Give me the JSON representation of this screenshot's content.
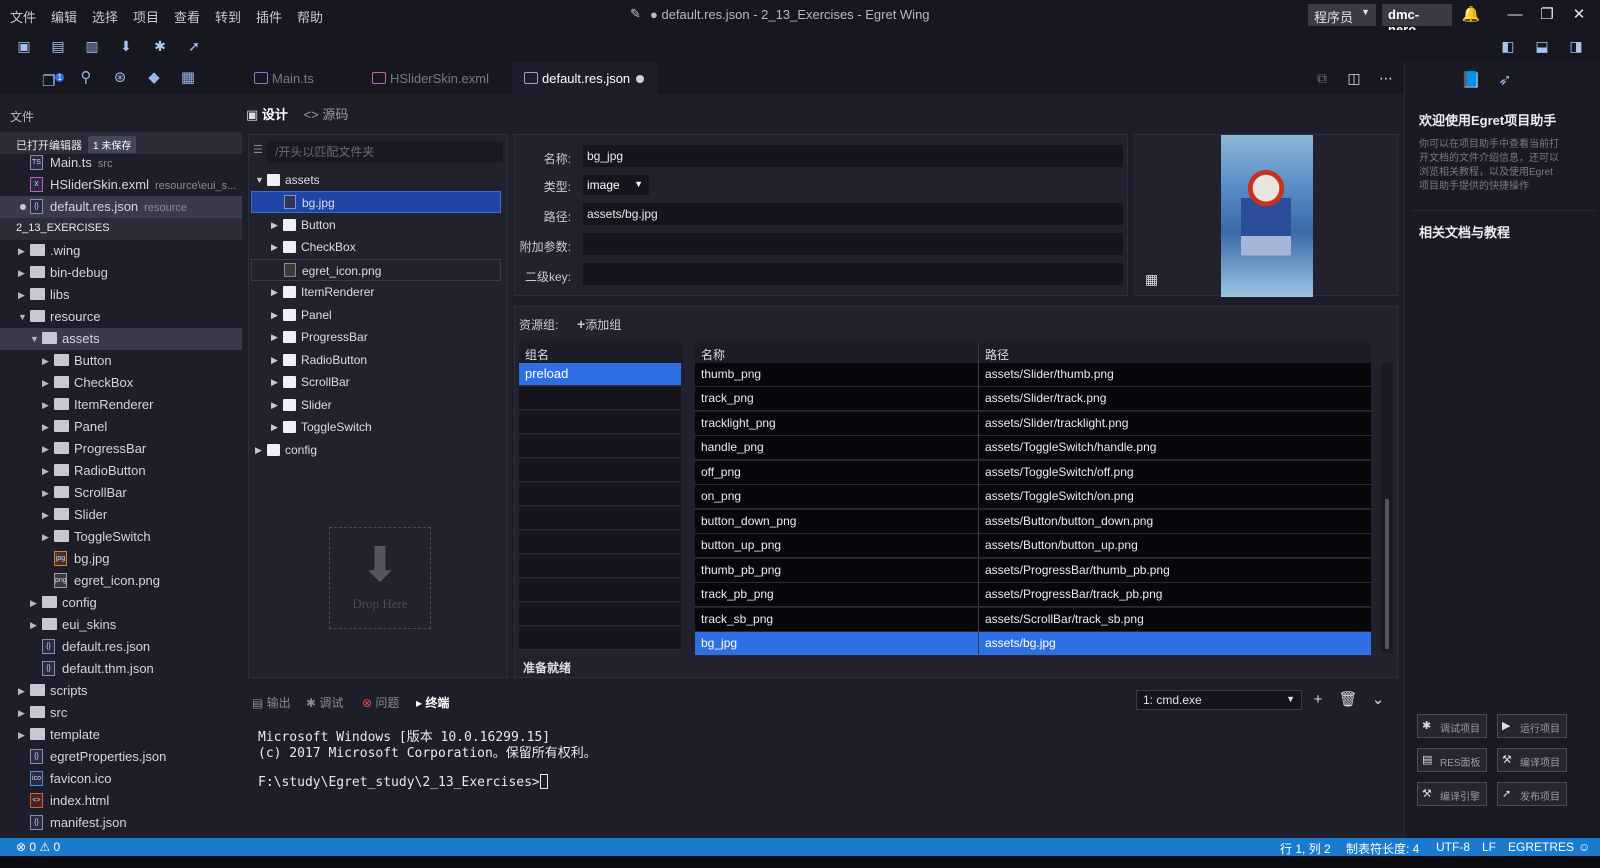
{
  "menu": [
    "文件",
    "编辑",
    "选择",
    "项目",
    "查看",
    "转到",
    "插件",
    "帮助"
  ],
  "window": {
    "title": "● default.res.json - 2_13_Exercises - Egret Wing",
    "role": "程序员",
    "user": "dmc-nero"
  },
  "activity": {
    "explorer_badge": "1"
  },
  "tabs": [
    {
      "label": "Main.ts"
    },
    {
      "label": "HSliderSkin.exml"
    },
    {
      "label": "default.res.json"
    }
  ],
  "sidebar": {
    "title": "文件",
    "open_editors": {
      "header": "已打开编辑器",
      "unsaved_badge": "1 未保存"
    },
    "open_files": [
      {
        "name": "Main.ts",
        "desc": "src"
      },
      {
        "name": "HSliderSkin.exml",
        "desc": "resource\\eui_s..."
      },
      {
        "name": "default.res.json",
        "desc": "resource"
      }
    ],
    "project": {
      "header": "2_13_EXERCISES"
    },
    "tree": [
      ".wing",
      "bin-debug",
      "libs",
      "resource",
      "assets",
      "Button",
      "CheckBox",
      "ItemRenderer",
      "Panel",
      "ProgressBar",
      "RadioButton",
      "ScrollBar",
      "Slider",
      "ToggleSwitch",
      "bg.jpg",
      "egret_icon.png",
      "config",
      "eui_skins",
      "default.res.json",
      "default.thm.json",
      "scripts",
      "src",
      "template",
      "egretProperties.json",
      "favicon.ico",
      "index.html",
      "manifest.json"
    ]
  },
  "editor": {
    "view_design": "设计",
    "view_source": "<> 源码",
    "filter_placeholder": "/开头以匹配文件夹",
    "filetree": [
      "assets",
      "bg.jpg",
      "Button",
      "CheckBox",
      "egret_icon.png",
      "ItemRenderer",
      "Panel",
      "ProgressBar",
      "RadioButton",
      "ScrollBar",
      "Slider",
      "ToggleSwitch",
      "config"
    ],
    "drop_here": "Drop Here",
    "props": {
      "name_label": "名称:",
      "name_value": "bg_jpg",
      "type_label": "类型:",
      "type_value": "image",
      "path_label": "路径:",
      "path_value": "assets/bg.jpg",
      "extra_label": "附加参数:",
      "extra_value": "",
      "subkey_label": "二级key:",
      "subkey_value": ""
    },
    "groups": {
      "label": "资源组:",
      "add_label": "添加组",
      "col_group": "组名",
      "items": [
        "preload"
      ],
      "col_name": "名称",
      "col_path": "路径",
      "rows": [
        {
          "name": "thumb_png",
          "path": "assets/Slider/thumb.png"
        },
        {
          "name": "track_png",
          "path": "assets/Slider/track.png"
        },
        {
          "name": "tracklight_png",
          "path": "assets/Slider/tracklight.png"
        },
        {
          "name": "handle_png",
          "path": "assets/ToggleSwitch/handle.png"
        },
        {
          "name": "off_png",
          "path": "assets/ToggleSwitch/off.png"
        },
        {
          "name": "on_png",
          "path": "assets/ToggleSwitch/on.png"
        },
        {
          "name": "button_down_png",
          "path": "assets/Button/button_down.png"
        },
        {
          "name": "button_up_png",
          "path": "assets/Button/button_up.png"
        },
        {
          "name": "thumb_pb_png",
          "path": "assets/ProgressBar/thumb_pb.png"
        },
        {
          "name": "track_pb_png",
          "path": "assets/ProgressBar/track_pb.png"
        },
        {
          "name": "track_sb_png",
          "path": "assets/ScrollBar/track_sb.png"
        },
        {
          "name": "bg_jpg",
          "path": "assets/bg.jpg"
        }
      ],
      "status": "准备就绪"
    }
  },
  "panel": {
    "tabs": [
      "输出",
      "调试",
      "问题",
      "终端"
    ],
    "terminal_select": "1: cmd.exe",
    "lines": [
      "Microsoft Windows [版本 10.0.16299.15]",
      "(c) 2017 Microsoft Corporation。保留所有权利。",
      "",
      "F:\\study\\Egret_study\\2_13_Exercises>"
    ]
  },
  "rightpanel": {
    "welcome": "欢迎使用Egret项目助手",
    "desc": "你可以在项目助手中查看当前打\n开文档的文件介绍信息，还可以\n浏览相关教程，以及使用Egret\n项目助手提供的快捷操作",
    "docs": "相关文档与教程",
    "buttons": [
      "调试项目",
      "运行项目",
      "RES面板",
      "编译项目",
      "编译引擎",
      "发布项目"
    ]
  },
  "statusbar": {
    "errors": "0",
    "warnings": "0",
    "position": "行 1, 列 2",
    "tab_size": "制表符长度: 4",
    "encoding": "UTF-8",
    "eol": "LF",
    "mode": "EGRETRES"
  },
  "colors": {
    "accent": "#2f6fe4",
    "status": "#1a7acd",
    "bg": "#1e1e2a"
  }
}
